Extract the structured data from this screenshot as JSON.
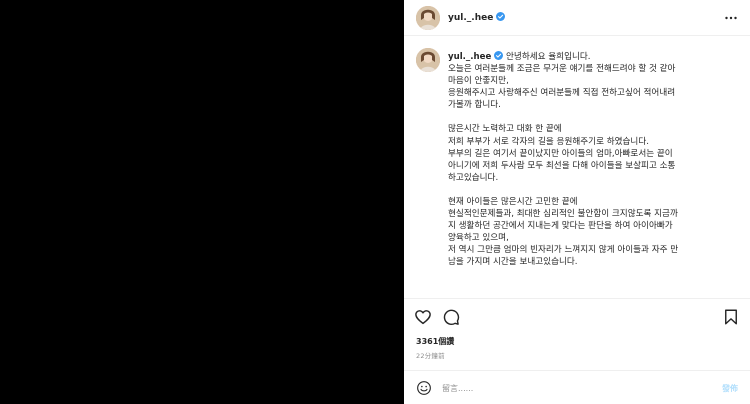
{
  "header": {
    "username": "yul._.hee"
  },
  "caption": {
    "username": "yul._.hee",
    "first_line": "안녕하세요 율희입니다.",
    "paragraphs": [
      [
        "오늘은 여러분들께 조금은 무거운 얘기를 전해드려야 할 것 같아",
        "마음이 안좋지만,",
        "응원해주시고 사랑해주신 여러분들께 직접 전하고싶어 적어내려",
        "가볼까 합니다."
      ],
      [
        "많은시간 노력하고 대화 한 끝에",
        "저희 부부가 서로 각자의 길을 응원해주기로 하였습니다.",
        "부부의 길은 여기서 끝이났지만 아이들의 엄마,아빠로서는 끝이",
        "아니기에 저희 두사람 모두 최선을 다해 아이들을 보살피고 소통",
        "하고있습니다."
      ],
      [
        "현재 아이들은 많은시간 고민한 끝에",
        "현실적인문제들과, 최대한 심리적인 불안함이 크지않도록 지금까",
        "지 생활하던 공간에서 지내는게 맞다는 판단을 하여 아이아빠가",
        "양육하고 있으며,",
        "저 역시 그만큼 엄마의 빈자리가 느껴지지 않게 아이들과 자주 만",
        "남을 가지며 시간을 보내고있습니다."
      ]
    ]
  },
  "likes": "3361個讚",
  "time": "22分鐘前",
  "comment": {
    "placeholder": "留言......",
    "post_label": "發佈"
  },
  "icons": {
    "verified": "verified-badge-icon",
    "more": "more-horizontal-icon",
    "like": "heart-icon",
    "comment": "comment-icon",
    "save": "bookmark-icon",
    "emoji": "emoji-icon"
  },
  "colors": {
    "verified": "#3897f0",
    "post_button": "#b2dffc",
    "muted": "#8e8e8e"
  }
}
